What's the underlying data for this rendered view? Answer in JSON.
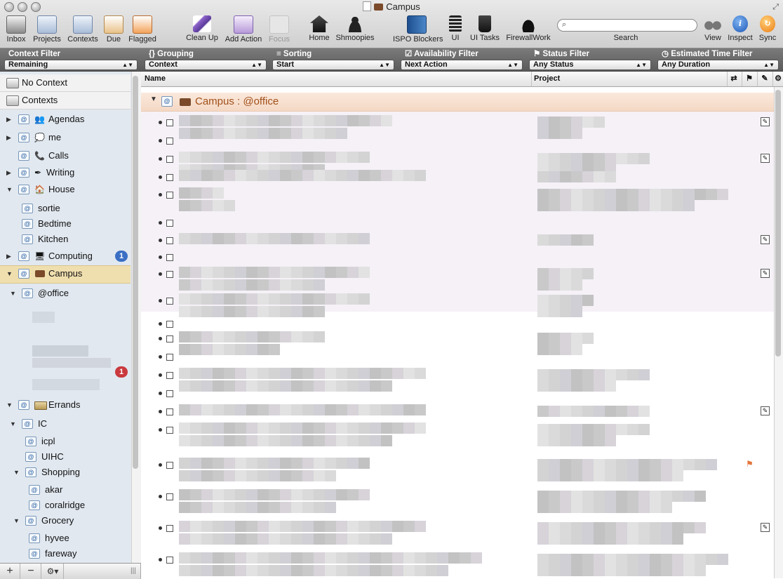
{
  "window": {
    "title": "Campus"
  },
  "toolbar": {
    "inbox": "Inbox",
    "projects": "Projects",
    "contexts": "Contexts",
    "due": "Due",
    "flagged": "Flagged",
    "clean_up": "Clean Up",
    "add_action": "Add Action",
    "focus": "Focus",
    "home": "Home",
    "shmoopies": "Shmoopies",
    "ispo_blockers": "ISPO Blockers",
    "ui": "UI",
    "ui_tasks": "UI Tasks",
    "firewallwork": "FirewallWork",
    "search_label": "Search",
    "view": "View",
    "inspect": "Inspect",
    "sync": "Sync",
    "search_value": ""
  },
  "filters": {
    "context": {
      "title": "Context Filter",
      "value": "Remaining"
    },
    "grouping": {
      "title": "Grouping",
      "value": "Context"
    },
    "sorting": {
      "title": "Sorting",
      "value": "Start"
    },
    "availability": {
      "title": "Availability Filter",
      "value": "Next Action"
    },
    "status": {
      "title": "Status Filter",
      "value": "Any Status"
    },
    "time": {
      "title": "Estimated Time Filter",
      "value": "Any Duration"
    }
  },
  "sidebar": {
    "no_context": "No Context",
    "contexts": "Contexts",
    "items": [
      {
        "label": "Agendas"
      },
      {
        "label": "me"
      },
      {
        "label": "Calls"
      },
      {
        "label": "Writing"
      },
      {
        "label": "House"
      },
      {
        "label": "sortie"
      },
      {
        "label": "Bedtime"
      },
      {
        "label": "Kitchen"
      },
      {
        "label": "Computing",
        "count": "1"
      },
      {
        "label": "Campus"
      },
      {
        "label": "@office"
      },
      {
        "label": "Errands"
      },
      {
        "label": "IC"
      },
      {
        "label": "icpl"
      },
      {
        "label": "UIHC"
      },
      {
        "label": "Shopping"
      },
      {
        "label": "akar"
      },
      {
        "label": "coralridge"
      },
      {
        "label": "Grocery"
      },
      {
        "label": "hyvee"
      },
      {
        "label": "fareway"
      }
    ],
    "office_child_count": "1"
  },
  "columns": {
    "name": "Name",
    "project": "Project"
  },
  "group": {
    "title": "Campus : @office"
  },
  "colors": {
    "selection": "#f0dfae",
    "group_title": "#a1501a",
    "badge_blue": "#3a6fc4",
    "badge_red": "#c9393d"
  }
}
